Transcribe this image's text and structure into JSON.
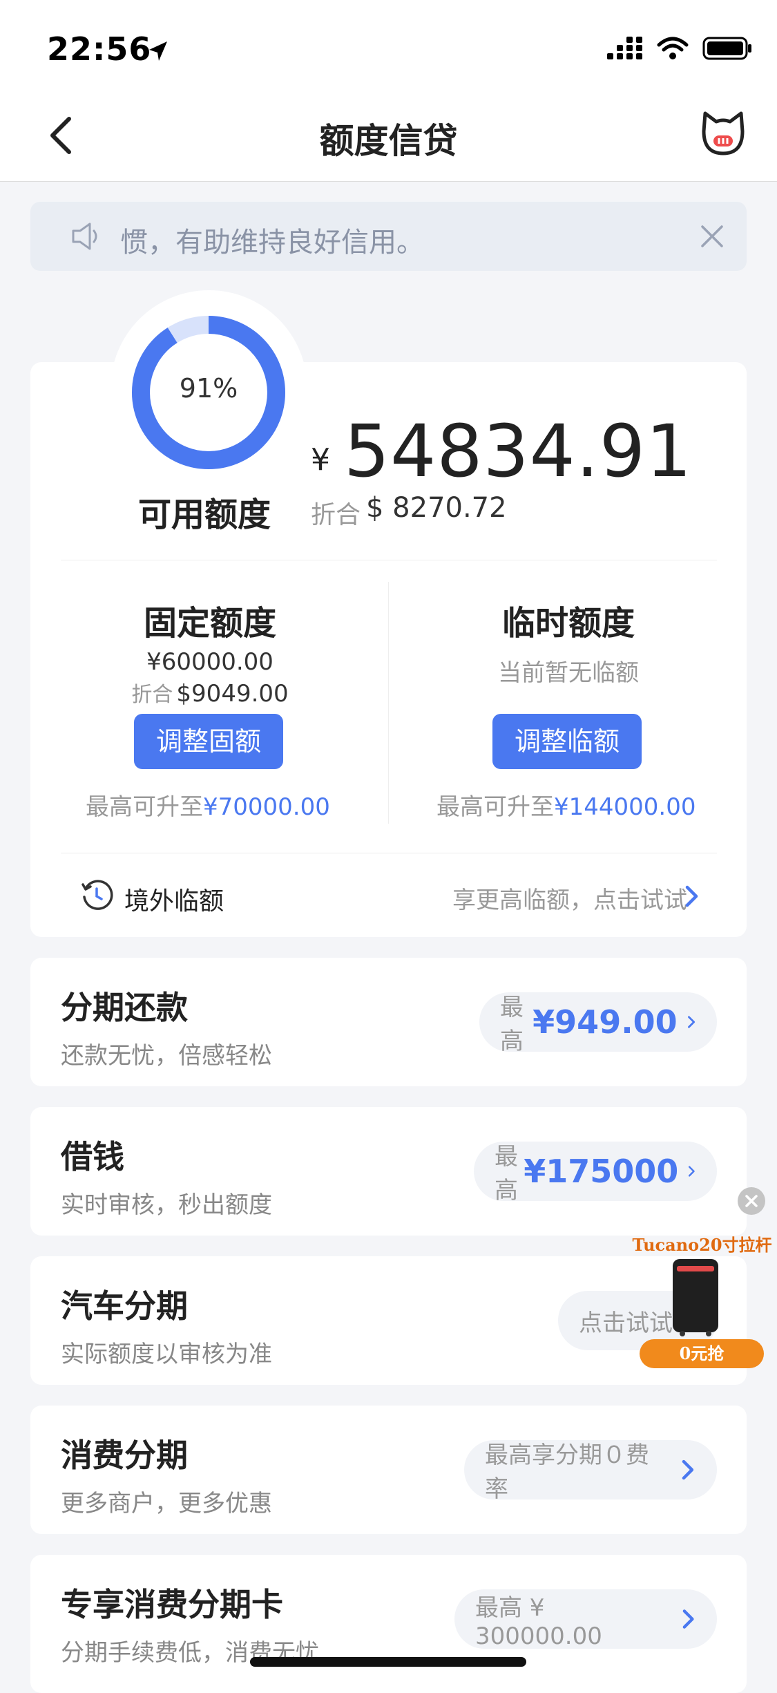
{
  "status_bar": {
    "time": "22:56"
  },
  "nav": {
    "title": "额度信贷"
  },
  "notice": {
    "text": "惯，有助维持良好信用。"
  },
  "credit": {
    "ring_percent": 91,
    "ring_label": "91%",
    "available_label": "可用额度",
    "currency_symbol": "¥",
    "available_amount": "54834.91",
    "usd_prefix": "折合",
    "usd_amount": "$ 8270.72"
  },
  "fixed": {
    "title": "固定额度",
    "amount": "¥60000.00",
    "usd_prefix": "折合",
    "usd_amount": "$9049.00",
    "button": "调整固额",
    "max_prefix": "最高可升至",
    "max_value": "¥70000.00"
  },
  "temp": {
    "title": "临时额度",
    "status": "当前暂无临额",
    "button": "调整临额",
    "max_prefix": "最高可升至",
    "max_value": "¥144000.00"
  },
  "overseas": {
    "label": "境外临额",
    "hint": "享更高临额，点击试试"
  },
  "items": [
    {
      "title": "分期还款",
      "subtitle": "还款无忧，倍感轻松",
      "pill_prefix": "最高",
      "pill_value": "¥949.00"
    },
    {
      "title": "借钱",
      "subtitle": "实时审核，秒出额度",
      "pill_prefix": "最高",
      "pill_value": "¥175000"
    },
    {
      "title": "汽车分期",
      "subtitle": "实际额度以审核为准",
      "pill_text": "点击试试"
    },
    {
      "title": "消费分期",
      "subtitle": "更多商户，更多优惠",
      "pill_text": "最高享分期０费率"
    },
    {
      "title": "专享消费分期卡",
      "subtitle": "分期手续费低，消费无忧",
      "pill_text": "最高 ¥ 300000.00"
    }
  ],
  "promo": {
    "title": "Tucano20寸拉杆箱",
    "badge": "0元抢"
  },
  "colors": {
    "accent": "#4a78f0",
    "ring_track": "#d8e2fb",
    "background": "#f4f5f8"
  }
}
